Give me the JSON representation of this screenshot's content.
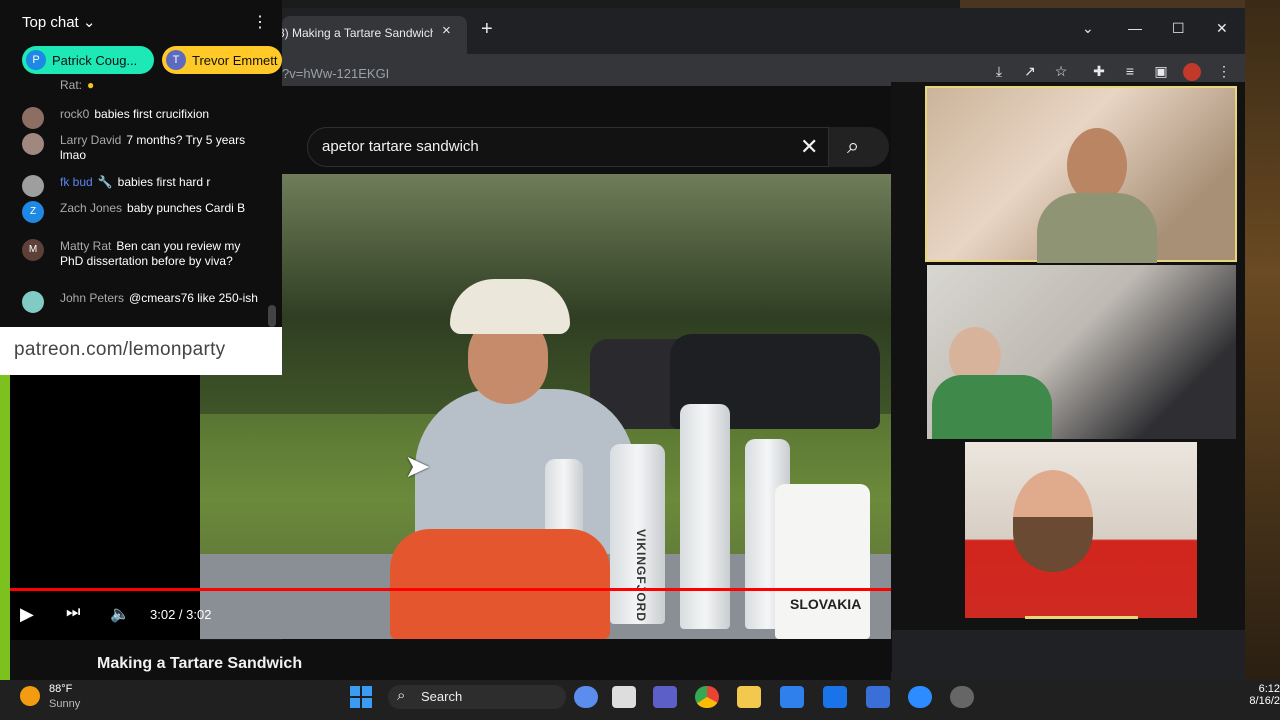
{
  "browser": {
    "tab_title": "8) Making a Tartare Sandwich",
    "new_tab": "+",
    "close_tab": "×",
    "url": "?v=hWw-121EKGI"
  },
  "youtube": {
    "search_value": "apetor tartare sandwich",
    "clear_glyph": "✕",
    "search_glyph": "⌕",
    "video_title": "Making a Tartare Sandwich",
    "time": "3:02 / 3:02",
    "progress_fraction": 1.0,
    "bottle_labels": [
      "VIKINGFJORD",
      "SLOVAKIA"
    ]
  },
  "chat": {
    "title": "Top chat",
    "pinned": [
      {
        "initial": "P",
        "name": "Patrick Coug...",
        "color": "#1e88e5"
      },
      {
        "initial": "T",
        "name": "Trevor Emmett",
        "color": "#5c6bc0"
      }
    ],
    "messages": [
      {
        "initial": "",
        "author": "Rat:",
        "text": "",
        "color": "#555"
      },
      {
        "initial": "",
        "author": "rock0",
        "text": "babies first crucifixion",
        "color": "#8d6e63"
      },
      {
        "initial": "",
        "author": "Larry David",
        "text": "7 months? Try 5 years lmao",
        "color": "#a1887f"
      },
      {
        "initial": "",
        "author": "fk bud",
        "text": "babies first hard r",
        "color": "#9e9e9e",
        "mod": true
      },
      {
        "initial": "Z",
        "author": "Zach Jones",
        "text": "baby punches Cardi B",
        "color": "#1e88e5"
      },
      {
        "initial": "M",
        "author": "Matty Rat",
        "text": "Ben can you review my PhD dissertation before by viva?",
        "color": "#5d4037"
      },
      {
        "initial": "",
        "author": "John Peters",
        "text": "@cmears76 like 250-ish",
        "color": "#80cbc4"
      }
    ],
    "patreon": "patreon.com/lemonparty"
  },
  "taskbar": {
    "temp": "88°F",
    "condition": "Sunny",
    "search": "Search",
    "time": "6:12",
    "date": "8/16/2"
  },
  "colors": {
    "accent_red": "#ff0000",
    "webcam_border": "#e7d67a",
    "obs_green": "#7dc11f"
  }
}
